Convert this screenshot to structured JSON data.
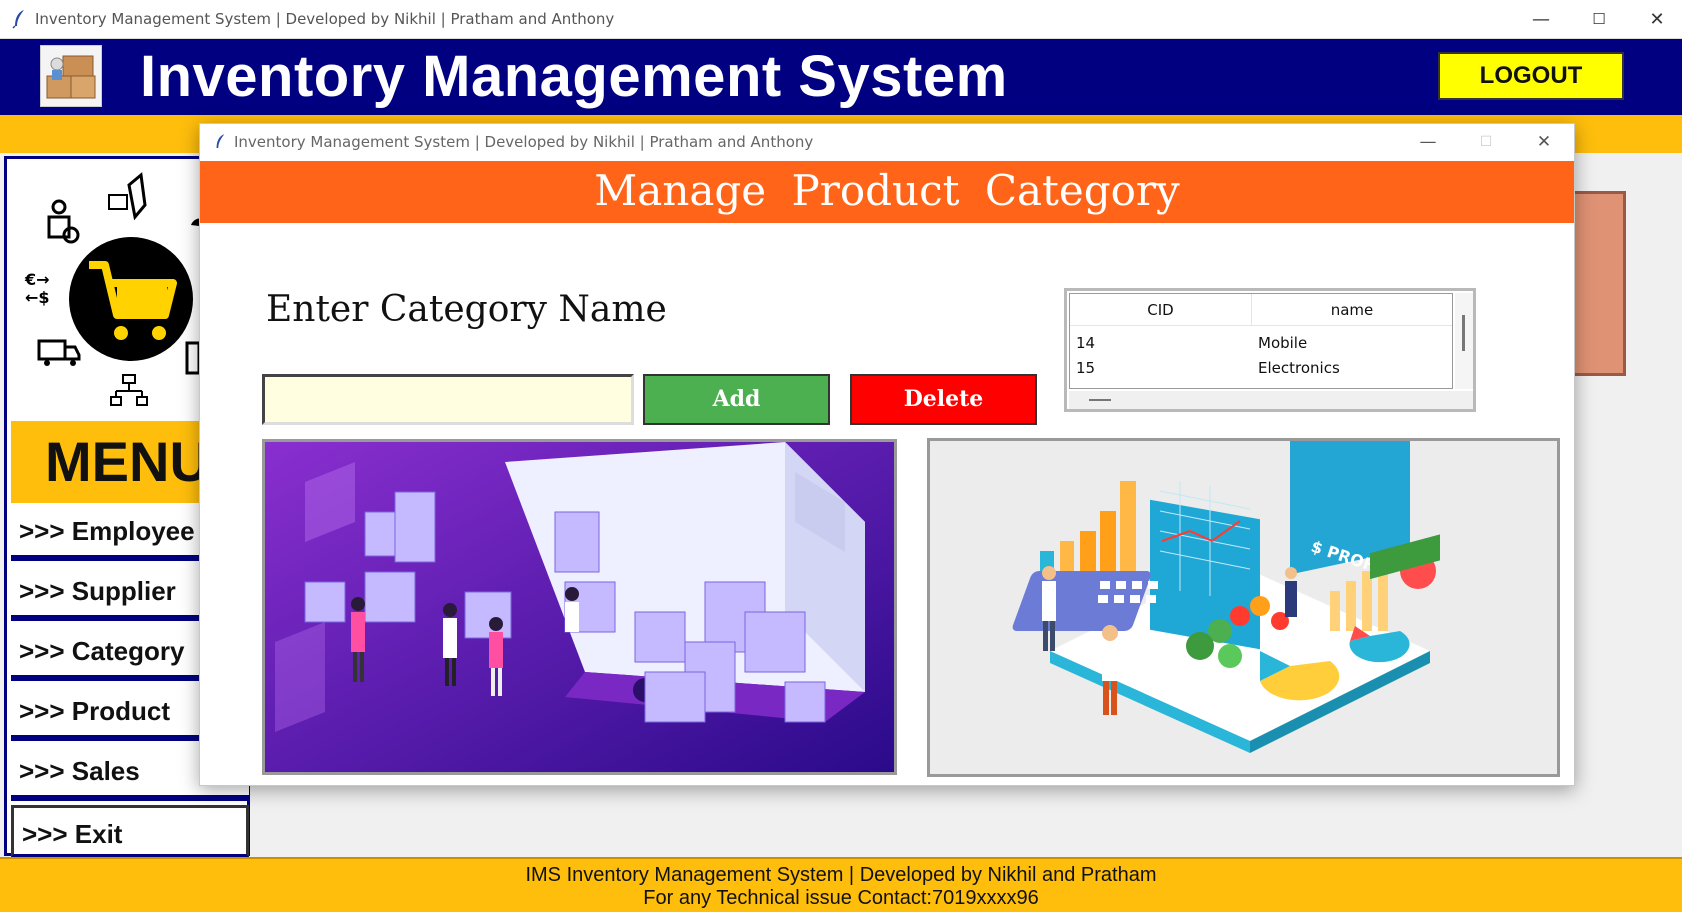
{
  "window": {
    "title": "Inventory Management System | Developed by Nikhil | Pratham and Anthony",
    "minimize": "—",
    "maximize": "☐",
    "close": "✕"
  },
  "header": {
    "title": "Inventory Management System",
    "logout_label": "LOGOUT"
  },
  "menu": {
    "heading": "MENU",
    "items": [
      {
        "label": ">>> Employee"
      },
      {
        "label": ">>> Supplier"
      },
      {
        "label": ">>> Category"
      },
      {
        "label": ">>> Product"
      },
      {
        "label": ">>> Sales"
      },
      {
        "label": ">>> Exit"
      }
    ]
  },
  "footer": {
    "line1": "IMS  Inventory Management System | Developed by Nikhil and Pratham",
    "line2": "For any Technical issue Contact:7019xxxx96"
  },
  "child": {
    "title": "Inventory Management System | Developed by Nikhil | Pratham and Anthony",
    "header": "Manage  Product  Category",
    "enter_label": "Enter Category Name",
    "input_value": "",
    "add_label": "Add",
    "delete_label": "Delete",
    "table": {
      "columns": [
        "CID",
        "name"
      ],
      "rows": [
        {
          "cid": "14",
          "name": "Mobile"
        },
        {
          "cid": "15",
          "name": "Electronics"
        }
      ]
    }
  },
  "colors": {
    "header_bg": "#010080",
    "accent_yellow": "#ffbe0c",
    "child_header": "#ff6418",
    "add_button": "#4caf50",
    "delete_button": "#ff0000"
  }
}
